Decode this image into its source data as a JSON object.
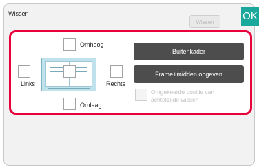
{
  "dialog": {
    "title": "Wissen",
    "clear_button": "Wissen",
    "ok_button": "OK"
  },
  "edges": {
    "top_label": "Omhoog",
    "left_label": "Links",
    "right_label": "Rechts",
    "bottom_label": "Omlaag"
  },
  "actions": {
    "outer_frame_button": "Buitenkader",
    "frame_center_button": "Frame+midden opgeven",
    "reverse_back_label_line1": "Omgekeerde positie van",
    "reverse_back_label_line2": "achterzijde wissen"
  },
  "colors": {
    "accent_ok": "#19a89b",
    "highlight_frame": "#e8003a",
    "dark_button": "#4d4d4d"
  }
}
